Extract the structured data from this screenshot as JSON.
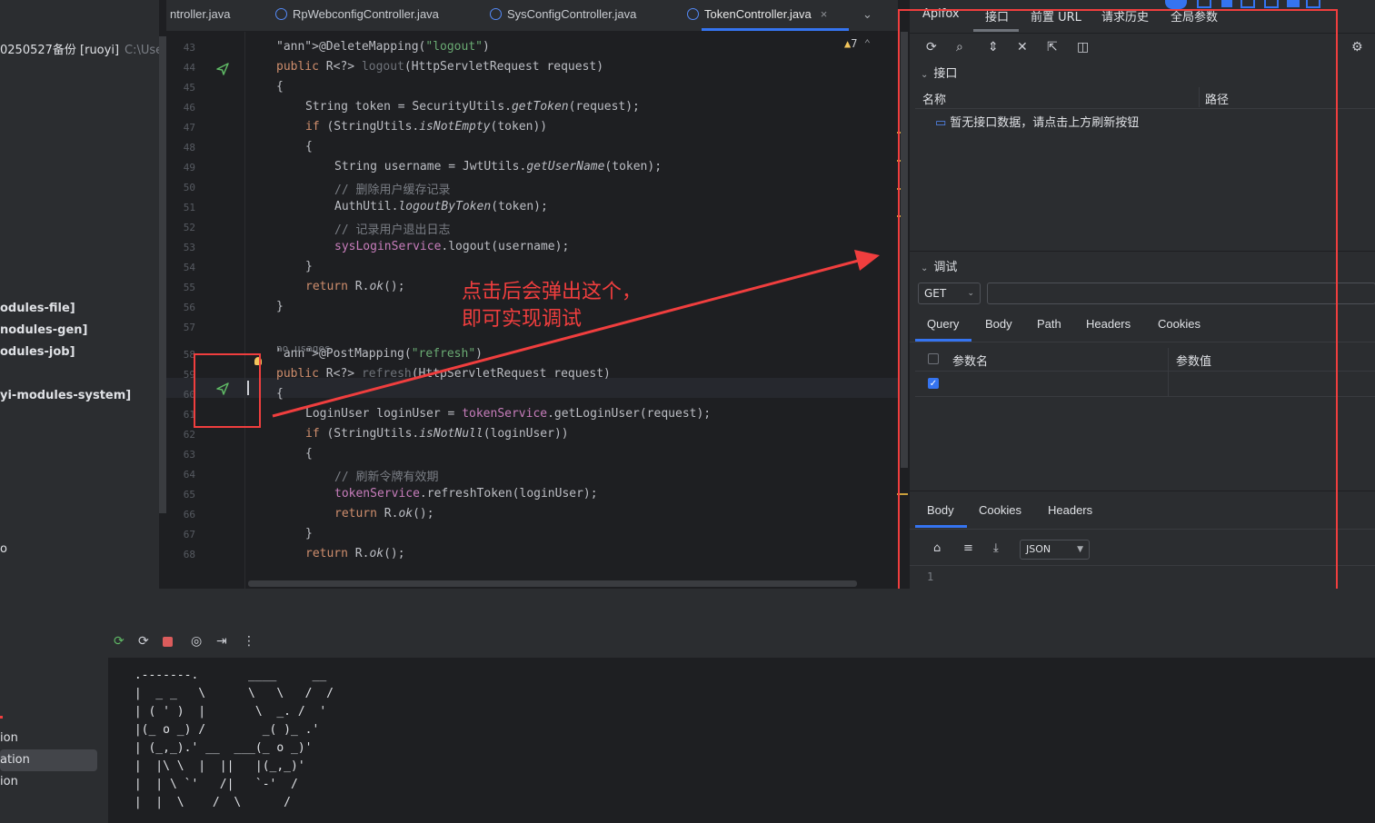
{
  "project": {
    "root_label": "0250527备份 [ruoyi]",
    "root_path": "C:\\Users",
    "modules": [
      "odules-file]",
      "nodules-gen]",
      "odules-job]",
      "yi-modules-system]"
    ],
    "misc": "o"
  },
  "tabs": [
    {
      "label": "ntroller.java"
    },
    {
      "label": "RpWebconfigController.java"
    },
    {
      "label": "SysConfigController.java"
    },
    {
      "label": "TokenController.java",
      "active": true
    }
  ],
  "tab_close": "×",
  "tab_menu": "⌄",
  "editor": {
    "warnings": "7",
    "no_usages_hint": "no usages",
    "lines": [
      {
        "n": "43",
        "text": "@DeleteMapping(\"logout\")"
      },
      {
        "n": "44",
        "text": "public R<?> logout(HttpServletRequest request)"
      },
      {
        "n": "45",
        "text": "{"
      },
      {
        "n": "46",
        "text": "String token = SecurityUtils.getToken(request);"
      },
      {
        "n": "47",
        "text": "if (StringUtils.isNotEmpty(token))"
      },
      {
        "n": "48",
        "text": "{"
      },
      {
        "n": "49",
        "text": "String username = JwtUtils.getUserName(token);"
      },
      {
        "n": "50",
        "text": "// 删除用户缓存记录"
      },
      {
        "n": "51",
        "text": "AuthUtil.logoutByToken(token);"
      },
      {
        "n": "52",
        "text": "// 记录用户退出日志"
      },
      {
        "n": "53",
        "text": "sysLoginService.logout(username);"
      },
      {
        "n": "54",
        "text": "}"
      },
      {
        "n": "55",
        "text": "return R.ok();"
      },
      {
        "n": "56",
        "text": "}"
      },
      {
        "n": "57",
        "text": ""
      },
      {
        "n": "58",
        "text": "@PostMapping(\"refresh\")"
      },
      {
        "n": "59",
        "text": "public R<?> refresh(HttpServletRequest request)"
      },
      {
        "n": "60",
        "text": "{"
      },
      {
        "n": "61",
        "text": "LoginUser loginUser = tokenService.getLoginUser(request);"
      },
      {
        "n": "62",
        "text": "if (StringUtils.isNotNull(loginUser))"
      },
      {
        "n": "63",
        "text": "{"
      },
      {
        "n": "64",
        "text": "// 刷新令牌有效期"
      },
      {
        "n": "65",
        "text": "tokenService.refreshToken(loginUser);"
      },
      {
        "n": "66",
        "text": "return R.ok();"
      },
      {
        "n": "67",
        "text": "}"
      },
      {
        "n": "68",
        "text": "return R.ok();"
      }
    ]
  },
  "apifox": {
    "tool_tabs": [
      "Apifox",
      "接口",
      "前置 URL",
      "请求历史",
      "全局参数"
    ],
    "api_section": "接口",
    "col_name": "名称",
    "col_path": "路径",
    "empty_msg": "暂无接口数据，请点击上方刷新按钮",
    "debug_section": "调试",
    "method": "GET",
    "url_value": "",
    "request_tabs": [
      "Query",
      "Body",
      "Path",
      "Headers",
      "Cookies"
    ],
    "param_name_col": "参数名",
    "param_value_col": "参数值",
    "response_tabs": [
      "Body",
      "Cookies",
      "Headers"
    ],
    "format": "JSON",
    "response_line": "1"
  },
  "overlay": {
    "line1": "点击后会弹出这个，",
    "line2": "即可实现调试",
    "color": "#f03e3e"
  },
  "run": {
    "left_items": [
      "ion",
      "ation",
      "ion"
    ],
    "ascii": [
      " .-------.       ____     __",
      " |  _ _   \\      \\   \\   /  /",
      " | ( ' )  |       \\  _. /  '",
      " |(_ o _) /        _( )_ .'",
      " | (_,_).' __  ___(_ o _)'",
      " |  |\\ \\  |  ||   |(_,_)'",
      " |  | \\ `'   /|   `-'  /",
      " |  |  \\    /  \\      /"
    ]
  }
}
